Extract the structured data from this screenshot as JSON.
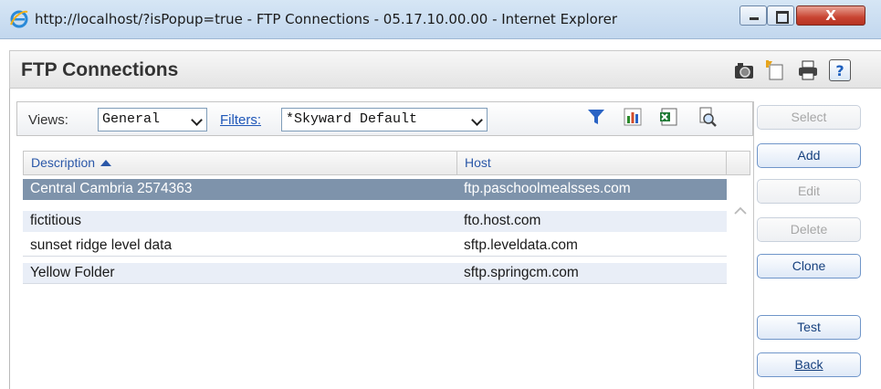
{
  "window": {
    "title": "http://localhost/?isPopup=true - FTP Connections - 05.17.10.00.00 - Internet Explorer",
    "close_glyph": "X"
  },
  "header": {
    "title": "FTP Connections",
    "icons": [
      "camera-icon",
      "new-window-icon",
      "print-icon",
      "help-icon"
    ],
    "help_glyph": "?"
  },
  "toolbar": {
    "views_label": "Views:",
    "views_value": "General",
    "filters_label": "Filters:",
    "filters_value": "*Skyward Default",
    "icons": [
      "filter-icon",
      "chart-icon",
      "excel-export-icon",
      "print-preview-icon"
    ]
  },
  "table": {
    "columns": [
      "Description",
      "Host"
    ],
    "sort_column": "Description",
    "sort_direction": "ascending",
    "rows": [
      {
        "description": "Central Cambria 2574363",
        "host": "ftp.paschoolmealsses.com",
        "selected": true
      },
      {
        "description": "fictitious",
        "host": "fto.host.com",
        "selected": false
      },
      {
        "description": "sunset ridge level data",
        "host": "sftp.leveldata.com",
        "selected": false
      },
      {
        "description": "Yellow Folder",
        "host": "sftp.springcm.com",
        "selected": false
      }
    ]
  },
  "actions": [
    {
      "label": "Select",
      "enabled": false
    },
    {
      "label": "Add",
      "enabled": true
    },
    {
      "label": "Edit",
      "enabled": false
    },
    {
      "label": "Delete",
      "enabled": false
    },
    {
      "label": "Clone",
      "enabled": true
    },
    {
      "label": "Test",
      "enabled": true
    },
    {
      "label": "Back",
      "enabled": true,
      "accesskey": "B"
    }
  ],
  "colors": {
    "selected_row": "#7e93ab",
    "alt_row": "#e9eef7",
    "link": "#1f57b8",
    "header_text": "#2b58a8"
  }
}
